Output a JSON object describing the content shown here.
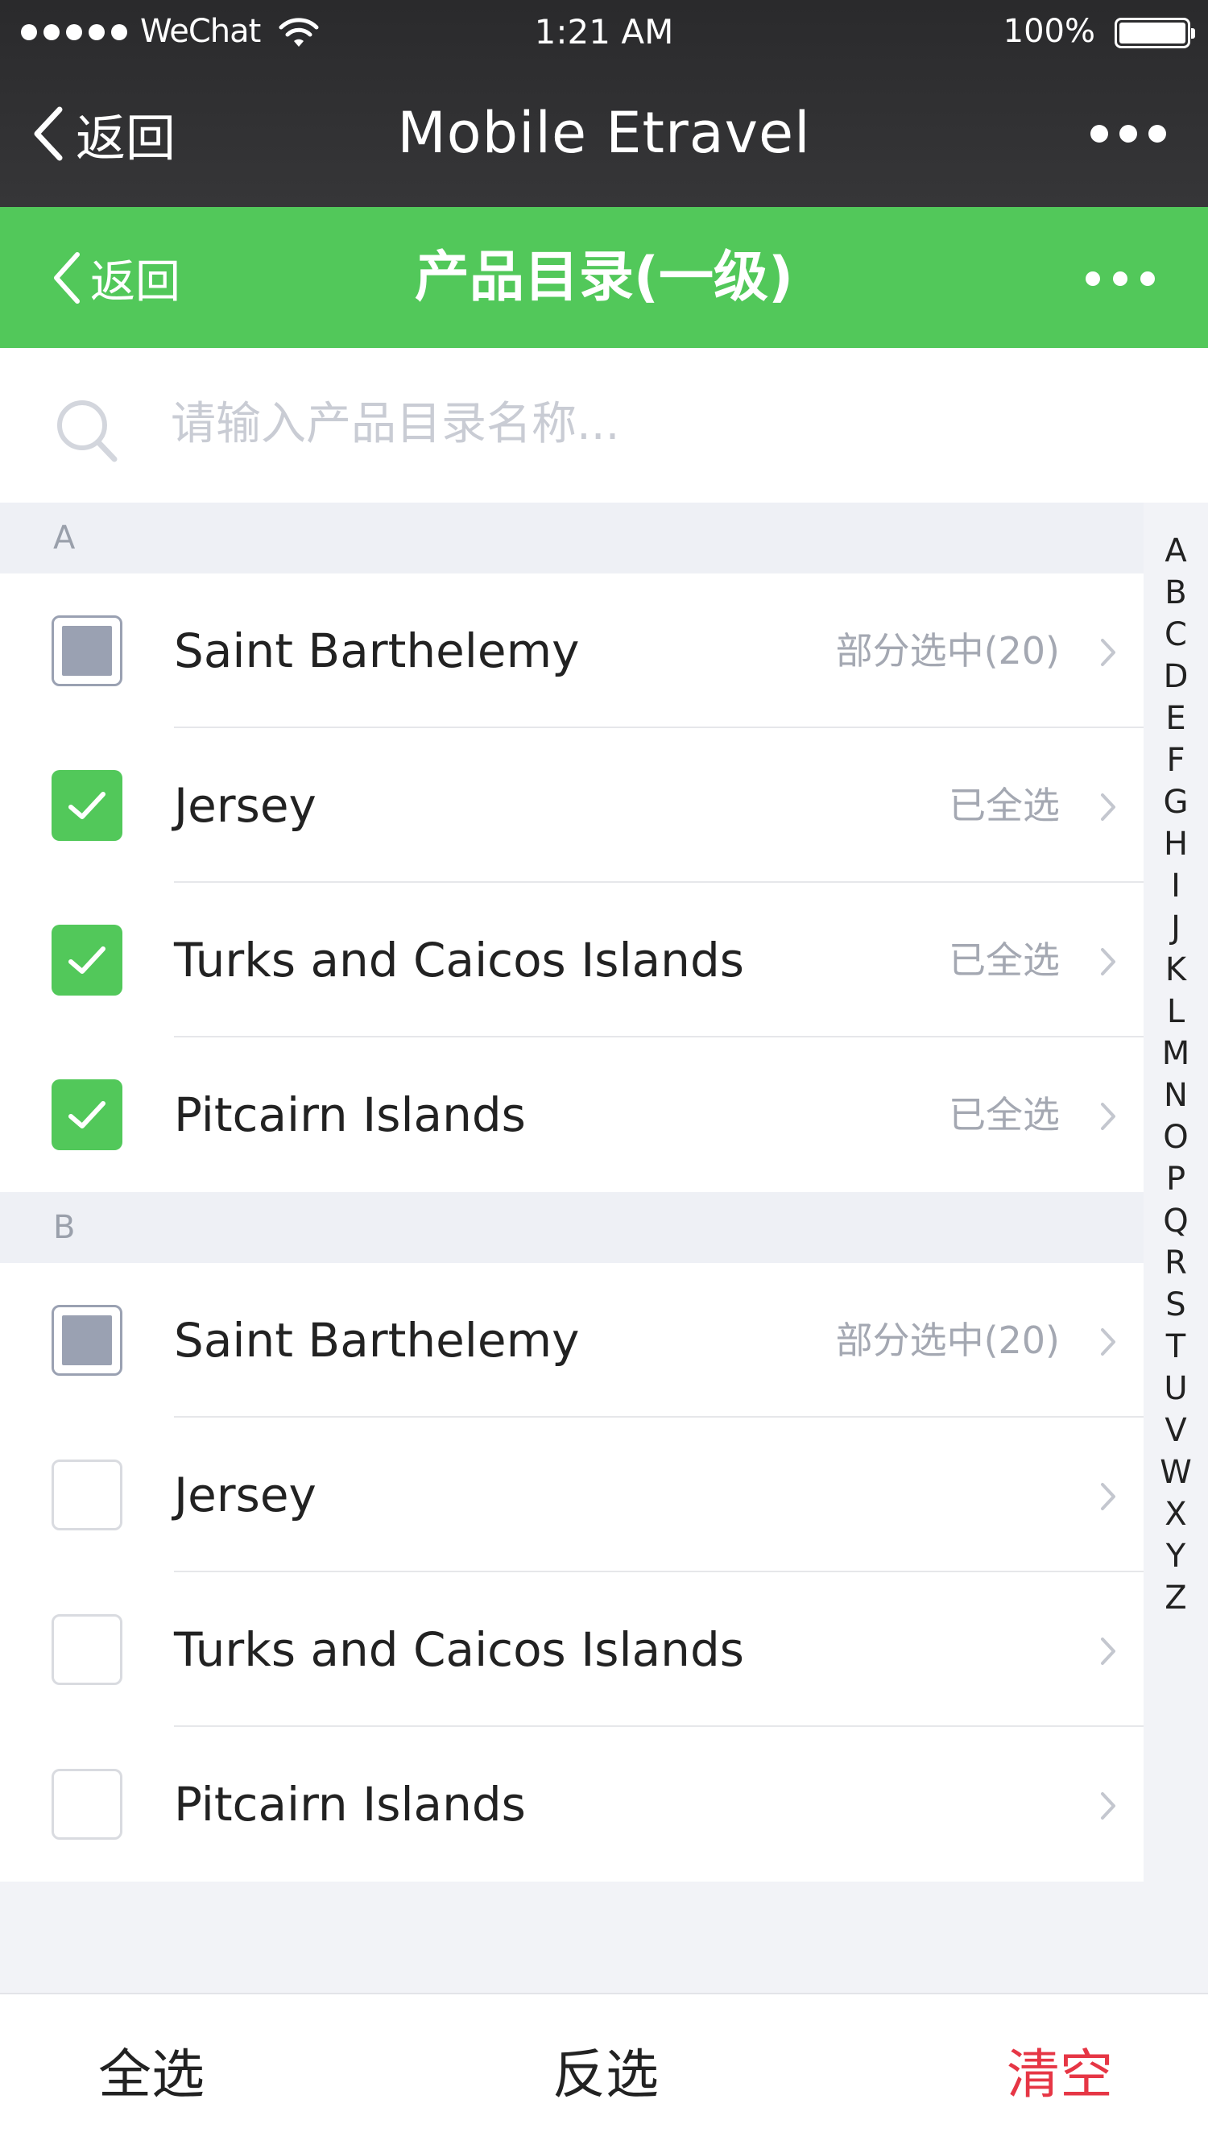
{
  "status_bar": {
    "carrier": "WeChat",
    "time": "1:21 AM",
    "battery": "100%"
  },
  "wechat_nav": {
    "back_label": "返回",
    "title": "Mobile Etravel"
  },
  "app_header": {
    "back_label": "返回",
    "title": "产品目录(一级)"
  },
  "search": {
    "placeholder": "请输入产品目录名称..."
  },
  "sections": [
    {
      "letter": "A",
      "items": [
        {
          "label": "Saint Barthelemy",
          "status": "部分选中(20)",
          "state": "partial"
        },
        {
          "label": "Jersey",
          "status": "已全选",
          "state": "checked"
        },
        {
          "label": "Turks and Caicos Islands",
          "status": "已全选",
          "state": "checked"
        },
        {
          "label": "Pitcairn Islands",
          "status": "已全选",
          "state": "checked"
        }
      ]
    },
    {
      "letter": "B",
      "items": [
        {
          "label": "Saint Barthelemy",
          "status": "部分选中(20)",
          "state": "partial"
        },
        {
          "label": "Jersey",
          "status": "",
          "state": "empty"
        },
        {
          "label": "Turks and Caicos Islands",
          "status": "",
          "state": "empty"
        },
        {
          "label": "Pitcairn Islands",
          "status": "",
          "state": "empty"
        }
      ]
    }
  ],
  "alphabet": [
    "A",
    "B",
    "C",
    "D",
    "E",
    "F",
    "G",
    "H",
    "I",
    "J",
    "K",
    "L",
    "M",
    "N",
    "O",
    "P",
    "Q",
    "R",
    "S",
    "T",
    "U",
    "V",
    "W",
    "X",
    "Y",
    "Z"
  ],
  "bottom_bar": {
    "select_all": "全选",
    "invert": "反选",
    "clear": "清空"
  },
  "colors": {
    "accent_green": "#52c85a",
    "nav_dark": "#2f2f31",
    "danger_red": "#e63645",
    "partial_gray": "#9aa1b2"
  }
}
